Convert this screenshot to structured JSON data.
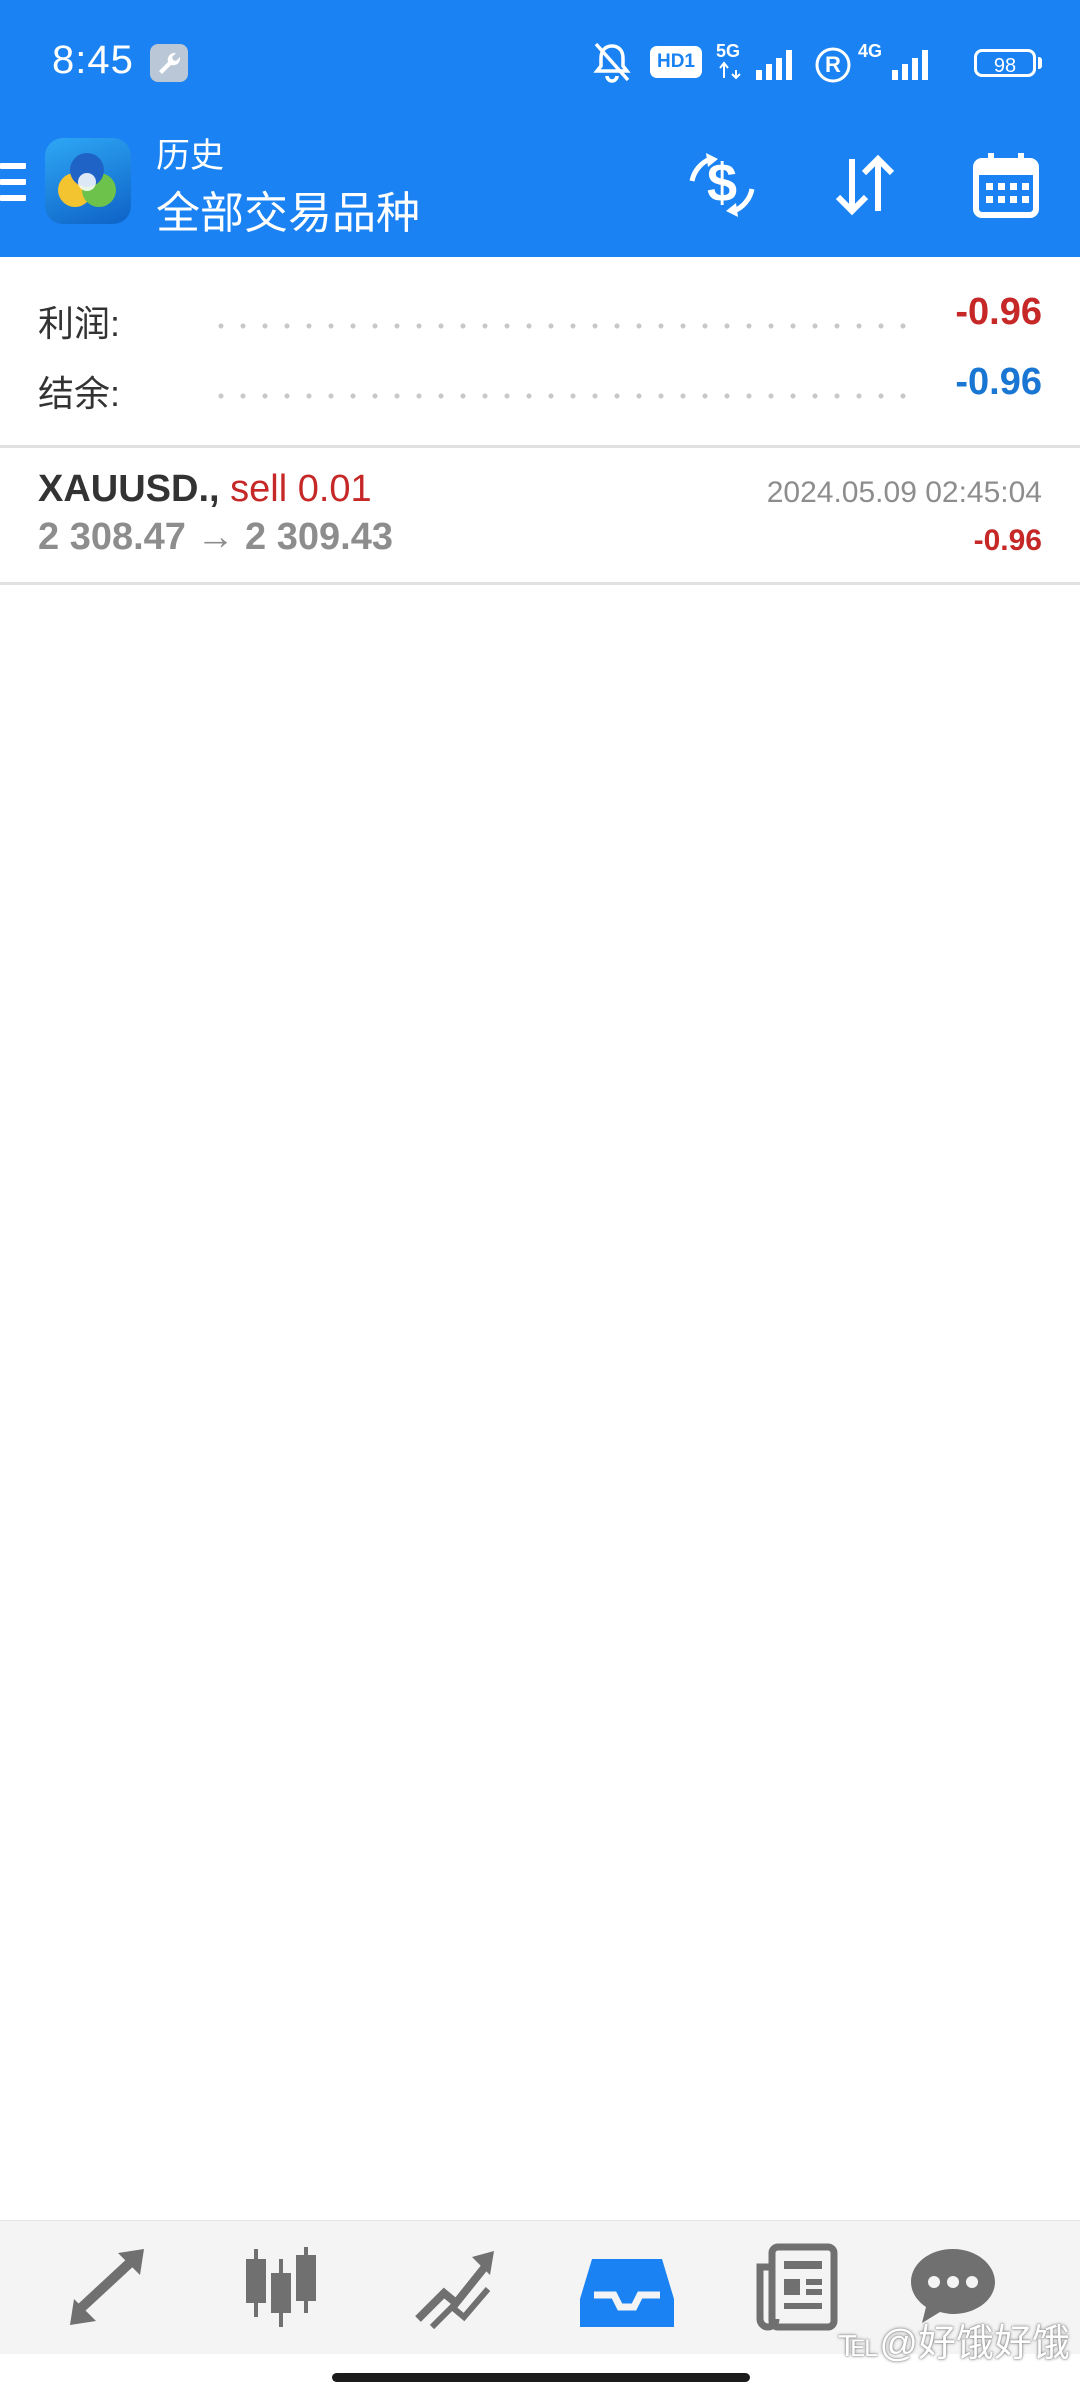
{
  "status_bar": {
    "time": "8:45",
    "network_primary": "5G",
    "network_secondary": "4G",
    "hd_label": "HD1",
    "roaming_label": "R",
    "battery": "98",
    "icons": [
      "wrench-icon",
      "mute-bell-icon",
      "signal-icon",
      "battery-icon"
    ]
  },
  "app_bar": {
    "subtitle": "历史",
    "title": "全部交易品种",
    "actions": [
      "currency-swap-icon",
      "sort-icon",
      "calendar-icon"
    ]
  },
  "summary": {
    "profit_label": "利润:",
    "profit_value": "-0.96",
    "balance_label": "结余:",
    "balance_value": "-0.96"
  },
  "deals": [
    {
      "symbol": "XAUUSD.,",
      "type": "sell 0.01",
      "open_price": "2 308.47",
      "arrow": "→",
      "close_price": "2 309.43",
      "time": "2024.05.09 02:45:04",
      "profit": "-0.96"
    }
  ],
  "bottom_nav": {
    "items": [
      "quotes-icon",
      "chart-icon",
      "trade-icon",
      "history-icon",
      "news-icon",
      "chat-icon"
    ],
    "active": "history-icon"
  },
  "watermark": "℡@好饿好饿",
  "colors": {
    "accent": "#1a82f2",
    "negative": "#c62828",
    "balance": "#1976d2",
    "muted": "#8d8d8d",
    "nav_inactive": "#707070"
  }
}
